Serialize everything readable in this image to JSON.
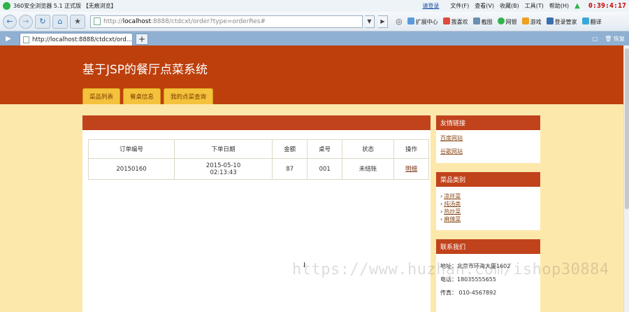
{
  "browser": {
    "title": "360安全浏览器 5.1 正式版 【无痕浏览】",
    "login": "请登录",
    "menus": [
      "文件(F)",
      "查看(V)",
      "收藏(B)",
      "工具(T)",
      "帮助(H)"
    ],
    "clock": "0:39:4:17",
    "url_prefix": "http://",
    "url_host": "localhost",
    "url_rest": ":8888/ctdcxt/order?type=orderRes#",
    "tools": [
      "扩展中心",
      "我喜欢",
      "截图",
      "网银",
      "游戏",
      "登录管家",
      "翻译"
    ],
    "tab_title": "http://localhost:8888/ctdcxt/ord...",
    "restore": "恢复",
    "colors": {
      "chrome": "#e2eaf2",
      "tabbar": "#8fb0d2"
    }
  },
  "site": {
    "title": "基于JSP的餐厅点菜系统",
    "nav": [
      "菜品列表",
      "餐桌信息",
      "我的点菜查询"
    ],
    "colors": {
      "header": "#bc3f0c",
      "background": "#fde8ac",
      "menu": "#f4c23c",
      "panel": "#c0431c"
    }
  },
  "orders": {
    "headers": [
      "订单编号",
      "下单日期",
      "金额",
      "桌号",
      "状态",
      "操作"
    ],
    "rows": [
      {
        "id": "20150160",
        "date": "2015-05-10",
        "time": "02:13:43",
        "amount": "87",
        "table": "001",
        "status": "未结账",
        "action": "明细"
      }
    ]
  },
  "sidebar": {
    "links": {
      "title": "友情链接",
      "items": [
        "百度网站",
        "谷歌网站"
      ]
    },
    "categories": {
      "title": "菜品类别",
      "items": [
        "凉拌菜",
        "炖汤类",
        "热炒菜",
        "麻辣菜"
      ]
    },
    "contact": {
      "title": "联系我们",
      "address": "地址：北京市环海大厦1602",
      "phone": "电话：18035555655",
      "fax": "传真： 010-4567892"
    }
  },
  "watermark": "https://www.huzhan.com/ishop30884"
}
